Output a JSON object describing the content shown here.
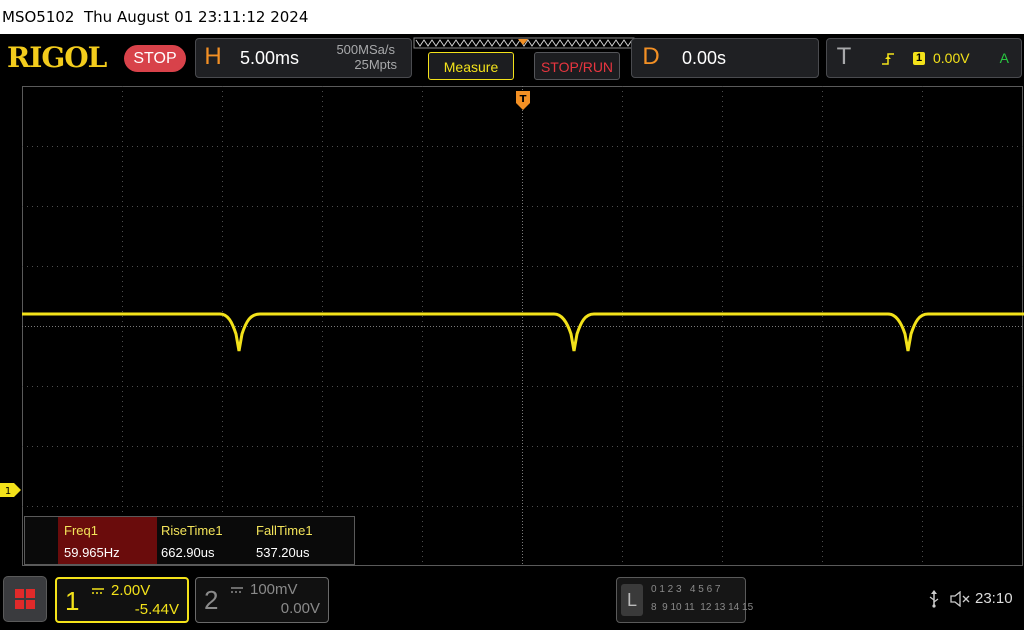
{
  "titlebar": {
    "model": "MSO5102",
    "datetime": "Thu August 01 23:11:12 2024"
  },
  "brand": {
    "logo": "RIGOL",
    "status": "STOP"
  },
  "horizontal": {
    "key": "H",
    "timebase": "5.00ms",
    "sample_rate": "500MSa/s",
    "memory_depth": "25Mpts"
  },
  "buttons": {
    "measure": "Measure",
    "stop_run": "STOP/RUN"
  },
  "delay": {
    "key": "D",
    "value": "0.00s"
  },
  "trigger": {
    "key": "T",
    "channel": "1",
    "level": "0.00V",
    "mode": "A"
  },
  "measurements": [
    {
      "label": "Freq1",
      "value": "59.965Hz"
    },
    {
      "label": "RiseTime1",
      "value": "662.90us"
    },
    {
      "label": "FallTime1",
      "value": "537.20us"
    }
  ],
  "channels": [
    {
      "number": "1",
      "scale": "2.00V",
      "offset": "-5.44V",
      "color": "#f3e21a",
      "active": true
    },
    {
      "number": "2",
      "scale": "100mV",
      "offset": "0.00V",
      "color": "#707070",
      "active": false
    }
  ],
  "logic": {
    "key": "L",
    "row1": "0 1 2 3   4 5 6 7",
    "row2": "8  9 10 11  12 13 14 15"
  },
  "status": {
    "clock": "23:10"
  },
  "colors": {
    "channel1": "#f3e21a",
    "accent": "#f39024",
    "stop": "#d8424a",
    "grid": "#5a5a5a"
  }
}
